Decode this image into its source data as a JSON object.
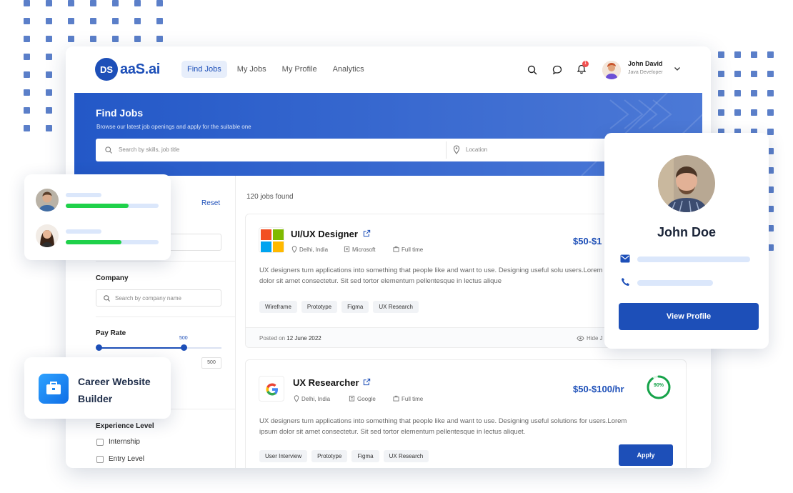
{
  "brand": {
    "badge": "DS",
    "name": "aaS.ai"
  },
  "nav": [
    {
      "label": "Find Jobs",
      "active": true
    },
    {
      "label": "My Jobs",
      "active": false
    },
    {
      "label": "My Profile",
      "active": false
    },
    {
      "label": "Analytics",
      "active": false
    }
  ],
  "user": {
    "name": "John David",
    "role": "Java Developer"
  },
  "notifications": {
    "count": "1"
  },
  "hero": {
    "title": "Find Jobs",
    "subtitle": "Browse our latest job openings and apply for the suitable one",
    "search_placeholder": "Search by skills, job title",
    "location_placeholder": "Location"
  },
  "filters": {
    "reset_label": "Reset",
    "company_label": "Company",
    "company_placeholder": "Search by company name",
    "pay_rate_label": "Pay Rate",
    "pay_rate_value": "500",
    "pay_rate_box": "500",
    "experience_label": "Experience Level",
    "experience_options": [
      "Internship",
      "Entry Level"
    ]
  },
  "results": {
    "count_text": "120 jobs found",
    "jobs": [
      {
        "title": "UI/UX Designer",
        "location": "Delhi, India",
        "company": "Microsoft",
        "type": "Full time",
        "salary": "$50-$1",
        "description": "UX designers turn applications into something that people like and want to use. Designing useful solu users.Lorem ipsum dolor sit amet consectetur. Sit sed tortor elementum pellentesque in lectus alique",
        "tags": [
          "Wireframe",
          "Prototype",
          "Figma",
          "UX Research"
        ],
        "posted_prefix": "Posted on",
        "posted_date": "12 June 2022",
        "hide_label": "Hide J"
      },
      {
        "title": "UX Researcher",
        "location": "Delhi, India",
        "company": "Google",
        "type": "Full time",
        "salary": "$50-$100/hr",
        "match": "90%",
        "match_value": 0.9,
        "description": "UX designers turn applications into something that people like and want to use. Designing useful solutions for users.Lorem ipsum dolor sit amet consectetur. Sit sed tortor elementum pellentesque in lectus aliquet.",
        "tags": [
          "User Interview",
          "Prototype",
          "Figma",
          "UX Research"
        ],
        "apply_label": "Apply"
      }
    ]
  },
  "team_card": {
    "progress": [
      0.68,
      0.6
    ]
  },
  "career_card": {
    "line1": "Career Website",
    "line2": "Builder"
  },
  "profile_card": {
    "name": "John Doe",
    "button_label": "View Profile"
  },
  "colors": {
    "primary": "#1d4fb8",
    "success": "#1fd14a",
    "hero_start": "#2358c7"
  }
}
